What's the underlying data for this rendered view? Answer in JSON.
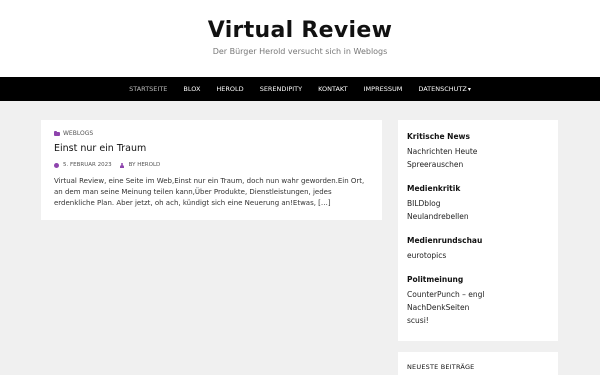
{
  "header": {
    "title": "Virtual Review",
    "tagline": "Der Bürger Herold versucht sich in Weblogs"
  },
  "nav": {
    "items": [
      {
        "label": "Startseite",
        "active": true
      },
      {
        "label": "Blox"
      },
      {
        "label": "Herold"
      },
      {
        "label": "Serendipity"
      },
      {
        "label": "Kontakt"
      },
      {
        "label": "Impressum"
      },
      {
        "label": "Datenschutz",
        "has_dropdown": true
      }
    ]
  },
  "post": {
    "category": "Weblogs",
    "title": "Einst nur ein Traum",
    "date": "5. Februar 2023",
    "author_prefix": "by",
    "author": "Herold",
    "excerpt": "Virtual Review, eine Seite im Web,Einst nur ein Traum, doch nun wahr geworden.Ein Ort, an dem man seine Meinung teilen kann,Über Produkte, Dienstleistungen, jedes erdenkliche Plan. Aber jetzt, oh ach, kündigt sich eine Neuerung an!Etwas, […]"
  },
  "sidebar": {
    "widgets": [
      {
        "title": "Kritische News",
        "links": [
          "Nachrichten Heute",
          "Spreerauschen"
        ]
      },
      {
        "title": "Medienkritik",
        "links": [
          "BILDblog",
          "Neulandrebellen"
        ]
      },
      {
        "title": "Medienrundschau",
        "links": [
          "eurotopics"
        ]
      },
      {
        "title": "Politmeinung",
        "links": [
          "CounterPunch – engl",
          "NachDenkSeiten",
          "scusi!"
        ]
      }
    ]
  },
  "sidebar2": {
    "title": "Neueste Beiträge"
  },
  "colors": {
    "accent": "#8e44ad",
    "nav_bg": "#000000",
    "page_bg": "#f0f0f0"
  }
}
